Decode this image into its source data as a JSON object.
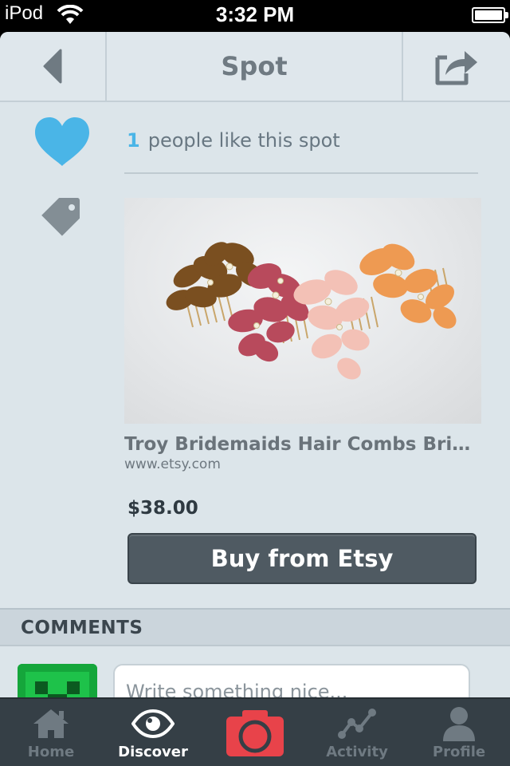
{
  "status_bar": {
    "carrier": "iPod",
    "time": "3:32 PM"
  },
  "nav": {
    "title": "Spot",
    "back_icon": "chevron-left-icon",
    "share_icon": "share-icon"
  },
  "likes": {
    "count": "1",
    "text": "people like this spot"
  },
  "product": {
    "title": "Troy Bridemaids Hair Combs Brid...",
    "source": "www.etsy.com",
    "price": "$38.00",
    "buy_label": "Buy from Etsy"
  },
  "comments": {
    "header": "COMMENTS",
    "placeholder": "Write something nice..."
  },
  "tabs": [
    {
      "label": "Home",
      "icon": "home-icon"
    },
    {
      "label": "Discover",
      "icon": "eye-icon",
      "active": true
    },
    {
      "label": "",
      "icon": "camera-icon"
    },
    {
      "label": "Activity",
      "icon": "activity-icon"
    },
    {
      "label": "Profile",
      "icon": "profile-icon"
    }
  ],
  "colors": {
    "accent_blue": "#4ab5e7",
    "camera_red": "#e8434a",
    "tab_bar": "#353f46",
    "buy_button": "#4f5a62"
  }
}
